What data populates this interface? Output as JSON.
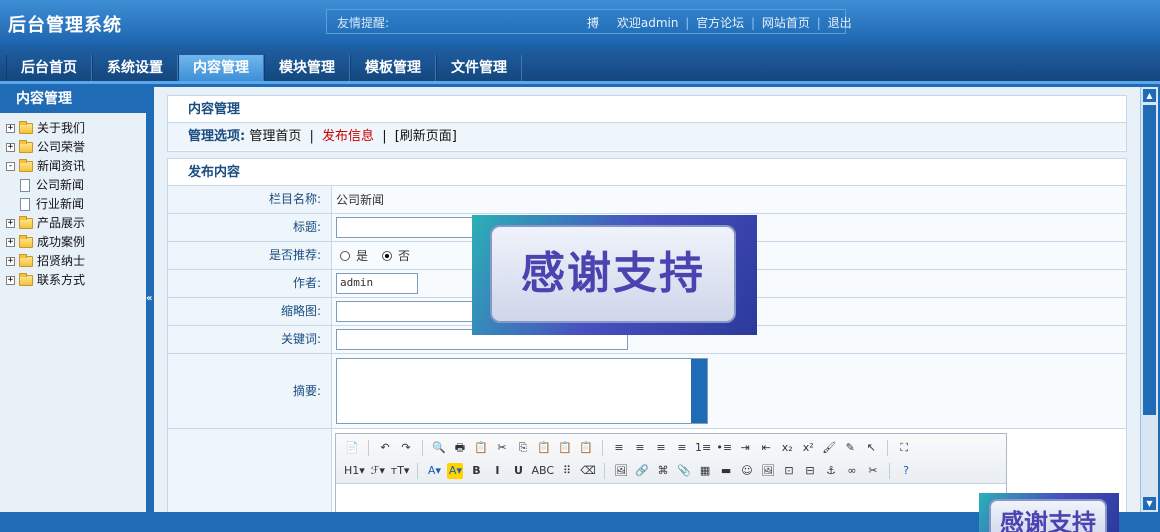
{
  "app": {
    "title": "后台管理系统"
  },
  "notice": {
    "label": "友情提醒:",
    "icon": "搏",
    "welcome": "欢迎admin",
    "links": [
      "官方论坛",
      "网站首页",
      "退出"
    ],
    "separator": "|"
  },
  "nav": {
    "tabs": [
      {
        "label": "后台首页",
        "active": false
      },
      {
        "label": "系统设置",
        "active": false
      },
      {
        "label": "内容管理",
        "active": true
      },
      {
        "label": "模块管理",
        "active": false
      },
      {
        "label": "模板管理",
        "active": false
      },
      {
        "label": "文件管理",
        "active": false
      }
    ]
  },
  "sidebar": {
    "title": "内容管理",
    "collapse": "«",
    "items": [
      {
        "label": "关于我们",
        "toggle": "+",
        "type": "folder"
      },
      {
        "label": "公司荣誉",
        "toggle": "+",
        "type": "folder"
      },
      {
        "label": "新闻资讯",
        "toggle": "-",
        "type": "folder"
      },
      {
        "label": "公司新闻",
        "toggle": "",
        "type": "doc"
      },
      {
        "label": "行业新闻",
        "toggle": "",
        "type": "doc"
      },
      {
        "label": "产品展示",
        "toggle": "+",
        "type": "folder"
      },
      {
        "label": "成功案例",
        "toggle": "+",
        "type": "folder"
      },
      {
        "label": "招贤纳士",
        "toggle": "+",
        "type": "folder"
      },
      {
        "label": "联系方式",
        "toggle": "+",
        "type": "folder"
      }
    ]
  },
  "main": {
    "panel_title": "内容管理",
    "options": {
      "label": "管理选项:",
      "home": "管理首页",
      "sep1": "|",
      "publish": "发布信息",
      "sep2": "|",
      "refresh": "[刷新页面]"
    },
    "form_title": "发布内容",
    "fields": {
      "column_label": "栏目名称:",
      "column_value": "公司新闻",
      "title_label": "标题:",
      "title_value": "",
      "recommend_label": "是否推荐:",
      "recommend_yes": "是",
      "recommend_no": "否",
      "recommend_selected": "否",
      "author_label": "作者:",
      "author_value": "admin",
      "thumb_label": "缩略图:",
      "thumb_value": "",
      "keywords_label": "关键词:",
      "keywords_value": "",
      "summary_label": "摘要:",
      "summary_value": ""
    },
    "editor_toolbar": {
      "row1": [
        "📄",
        "|",
        "↶",
        "↷",
        "|",
        "🔍",
        "🖶",
        "📋",
        "✂",
        "⎘",
        "📋",
        "📋",
        "📋",
        "|",
        "≡",
        "≡",
        "≡",
        "≡",
        "1≡",
        "•≡",
        "⇥",
        "⇤",
        "x₂",
        "x²",
        "🖌",
        "✎",
        "↖",
        "|",
        "⛶"
      ],
      "row2": [
        "H1▾",
        "ℱ▾",
        "тT▾",
        "|",
        "A▾",
        "A▾",
        "B",
        "I",
        "U",
        "ABC",
        "⠿",
        "⌫",
        "|",
        "🖼",
        "🔗",
        "⌘",
        "📎",
        "▦",
        "▬",
        "☺",
        "🖼",
        "⊡",
        "⊟",
        "⚓",
        "∞",
        "✂",
        "|",
        "?"
      ]
    }
  },
  "ads": {
    "text": "感谢支持"
  },
  "scrollbar": {
    "up": "▲",
    "down": "▼"
  }
}
